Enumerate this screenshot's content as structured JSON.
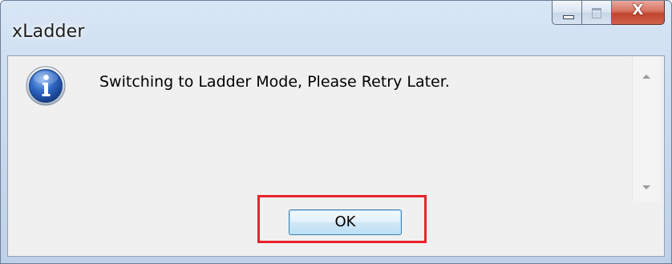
{
  "window": {
    "title": "xLadder",
    "caption_buttons": {
      "minimize_icon": "minimize-icon",
      "maximize_icon": "maximize-icon",
      "close_icon": "close-icon",
      "close_glyph": "X"
    }
  },
  "dialog": {
    "icon": "info-icon",
    "message": "Switching to Ladder Mode, Please Retry Later.",
    "ok_label": "OK"
  },
  "colors": {
    "highlight_border": "#e8232b",
    "ok_button_border": "#3c7fb1",
    "close_button": "#c0452f"
  }
}
